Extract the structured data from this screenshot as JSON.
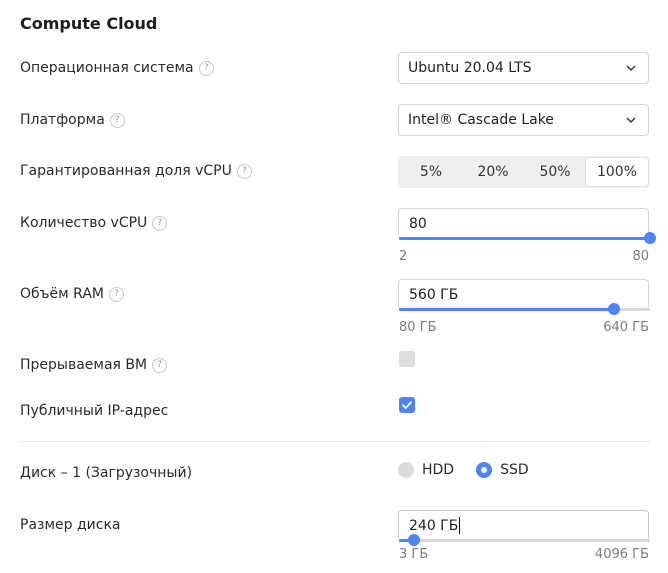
{
  "title": "Compute Cloud",
  "help_glyph": "?",
  "os": {
    "label": "Операционная система",
    "value": "Ubuntu 20.04 LTS"
  },
  "platform": {
    "label": "Платформа",
    "value": "Intel® Cascade Lake"
  },
  "vcpu_share": {
    "label": "Гарантированная доля vCPU",
    "options": [
      "5%",
      "20%",
      "50%",
      "100%"
    ],
    "selected": "100%"
  },
  "vcpu_count": {
    "label": "Количество vCPU",
    "value": "80",
    "min": "2",
    "max": "80",
    "fraction": 1.0
  },
  "ram": {
    "label": "Объём RAM",
    "value": "560 ГБ",
    "min": "80 ГБ",
    "max": "640 ГБ",
    "fraction": 0.8571
  },
  "preemptible": {
    "label": "Прерываемая ВМ",
    "checked": false
  },
  "public_ip": {
    "label": "Публичный IP-адрес",
    "checked": true
  },
  "disk": {
    "label": "Диск – 1 (Загрузочный)",
    "types": [
      "HDD",
      "SSD"
    ],
    "selected": "SSD"
  },
  "disk_size": {
    "label": "Размер диска",
    "value": "240 ГБ",
    "min": "3 ГБ",
    "max": "4096 ГБ",
    "fraction": 0.0579
  },
  "colors": {
    "accent": "#4f84f5",
    "track": "#d8d8d8",
    "border": "#d3d3d3"
  },
  "icons": {
    "select_chevron": "chevron-down-icon",
    "check": "check-icon",
    "help": "help-icon"
  }
}
